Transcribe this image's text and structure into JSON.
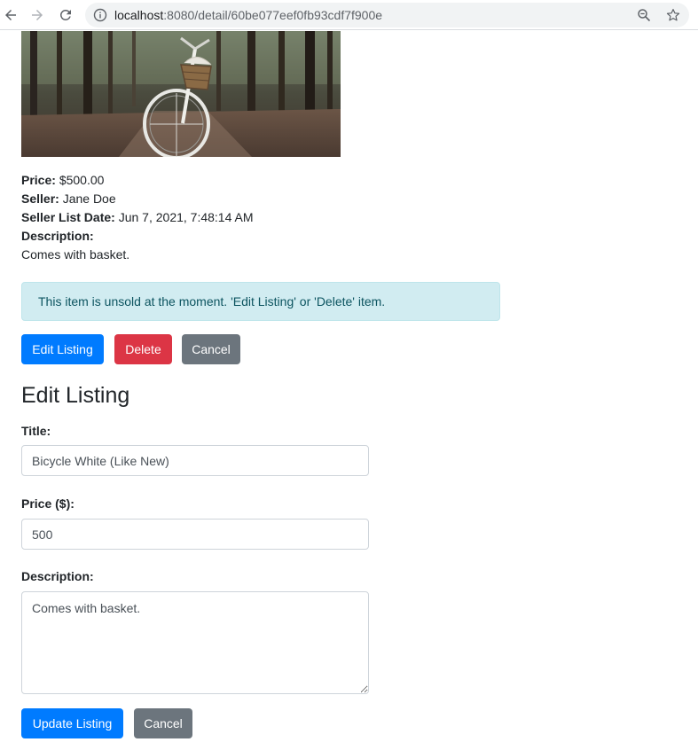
{
  "browser": {
    "url_host": "localhost",
    "url_rest": ":8080/detail/60be077eef0fb93cdf7f900e",
    "icons": [
      "back-arrow-icon",
      "forward-arrow-icon",
      "reload-icon",
      "info-icon",
      "zoom-icon",
      "star-icon"
    ]
  },
  "listing": {
    "image_alt": "bicycle-with-basket",
    "price_label": "Price:",
    "price_value": "$500.00",
    "seller_label": "Seller:",
    "seller_value": "Jane Doe",
    "date_label": "Seller List Date:",
    "date_value": "Jun 7, 2021, 7:48:14 AM",
    "description_label": "Description:",
    "description_value": "Comes with basket."
  },
  "alert": {
    "text": "This item is unsold at the moment. 'Edit Listing' or 'Delete' item."
  },
  "actions": {
    "edit_label": "Edit Listing",
    "delete_label": "Delete",
    "cancel_label": "Cancel"
  },
  "edit_form": {
    "heading": "Edit Listing",
    "title_label": "Title:",
    "title_value": "Bicycle White (Like New)",
    "price_label": "Price ($):",
    "price_value": "500",
    "description_label": "Description:",
    "description_value": "Comes with basket.",
    "update_label": "Update Listing",
    "cancel_label": "Cancel"
  },
  "colors": {
    "primary": "#007bff",
    "danger": "#dc3545",
    "secondary": "#6c757d",
    "alert_bg": "#d1ecf1",
    "alert_text": "#0c5460"
  }
}
